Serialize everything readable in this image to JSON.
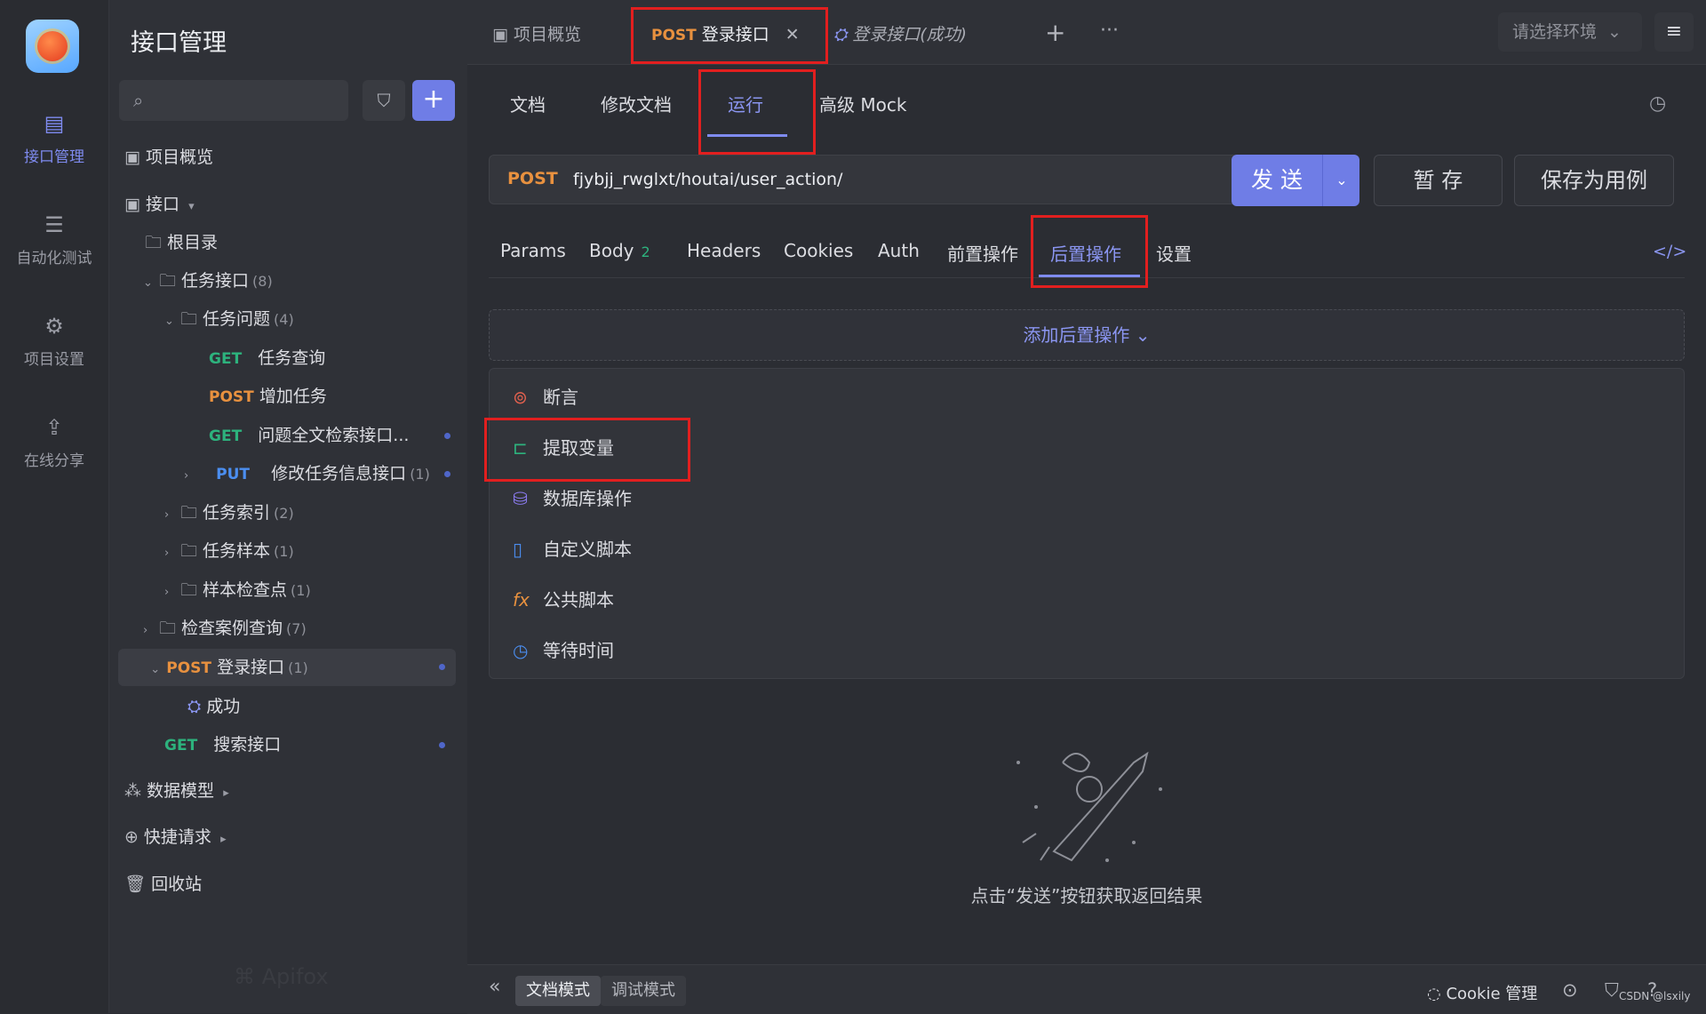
{
  "rail": {
    "items": [
      {
        "label": "接口管理",
        "icon": "api-manage-icon",
        "active": true
      },
      {
        "label": "自动化测试",
        "icon": "automation-test-icon",
        "active": false
      },
      {
        "label": "项目设置",
        "icon": "project-settings-icon",
        "active": false
      },
      {
        "label": "在线分享",
        "icon": "share-icon",
        "active": false
      }
    ]
  },
  "tree": {
    "title": "接口管理",
    "search_placeholder": "",
    "rows": [
      {
        "label": "项目概览"
      },
      {
        "label": "接口"
      },
      {
        "label": "根目录"
      },
      {
        "label": "任务接口",
        "count": "(8)"
      },
      {
        "label": "任务问题",
        "count": "(4)"
      },
      {
        "method": "GET",
        "label": "任务查询"
      },
      {
        "method": "POST",
        "label": "增加任务"
      },
      {
        "method": "GET",
        "label": "问题全文检索接口..."
      },
      {
        "method": "PUT",
        "label": "修改任务信息接口",
        "count": "(1)"
      },
      {
        "label": "任务索引",
        "count": "(2)"
      },
      {
        "label": "任务样本",
        "count": "(1)"
      },
      {
        "label": "样本检查点",
        "count": "(1)"
      },
      {
        "label": "检查案例查询",
        "count": "(7)"
      },
      {
        "method": "POST",
        "label": "登录接口",
        "count": "(1)"
      },
      {
        "label": "成功"
      },
      {
        "method": "GET",
        "label": "搜索接口"
      },
      {
        "label": "数据模型"
      },
      {
        "label": "快捷请求"
      },
      {
        "label": "回收站"
      }
    ],
    "watermark": "Apifox"
  },
  "tabs": {
    "items": [
      {
        "label": "项目概览"
      },
      {
        "method": "POST",
        "label": "登录接口"
      },
      {
        "label": "登录接口(成功)"
      }
    ],
    "more": "···",
    "env_select": "请选择环境"
  },
  "subtabs": [
    "文档",
    "修改文档",
    "运行",
    "高级 Mock"
  ],
  "request": {
    "method": "POST",
    "url": "fjybjj_rwglxt/houtai/user_action/",
    "send": "发 送",
    "save_temp": "暂 存",
    "save_case": "保存为用例"
  },
  "reqtabs": [
    {
      "label": "Params"
    },
    {
      "label": "Body",
      "badge": "2"
    },
    {
      "label": "Headers"
    },
    {
      "label": "Cookies"
    },
    {
      "label": "Auth"
    },
    {
      "label": "前置操作"
    },
    {
      "label": "后置操作"
    },
    {
      "label": "设置"
    }
  ],
  "post_ops": {
    "add_label": "添加后置操作",
    "menu": [
      {
        "label": "断言",
        "icon": "assert-icon",
        "color": "#e0604e"
      },
      {
        "label": "提取变量",
        "icon": "extract-variable-icon",
        "color": "#2db27d"
      },
      {
        "label": "数据库操作",
        "icon": "database-icon",
        "color": "#8b7bf0"
      },
      {
        "label": "自定义脚本",
        "icon": "script-icon",
        "color": "#4b8ef0"
      },
      {
        "label": "公共脚本",
        "icon": "fx-icon",
        "color": "#e8913f"
      },
      {
        "label": "等待时间",
        "icon": "clock-icon",
        "color": "#4b8ef0"
      }
    ]
  },
  "empty": {
    "text": "点击“发送”按钮获取返回结果"
  },
  "bottom": {
    "doc_mode": "文档模式",
    "debug_mode": "调试模式",
    "cookie": "Cookie 管理",
    "credit": "CSDN @lsxily"
  },
  "colors": {
    "accent": "#6f7de6",
    "get": "#2db27d",
    "post": "#e8913f",
    "put": "#4b8ef0",
    "highlight": "#e21f1f"
  }
}
